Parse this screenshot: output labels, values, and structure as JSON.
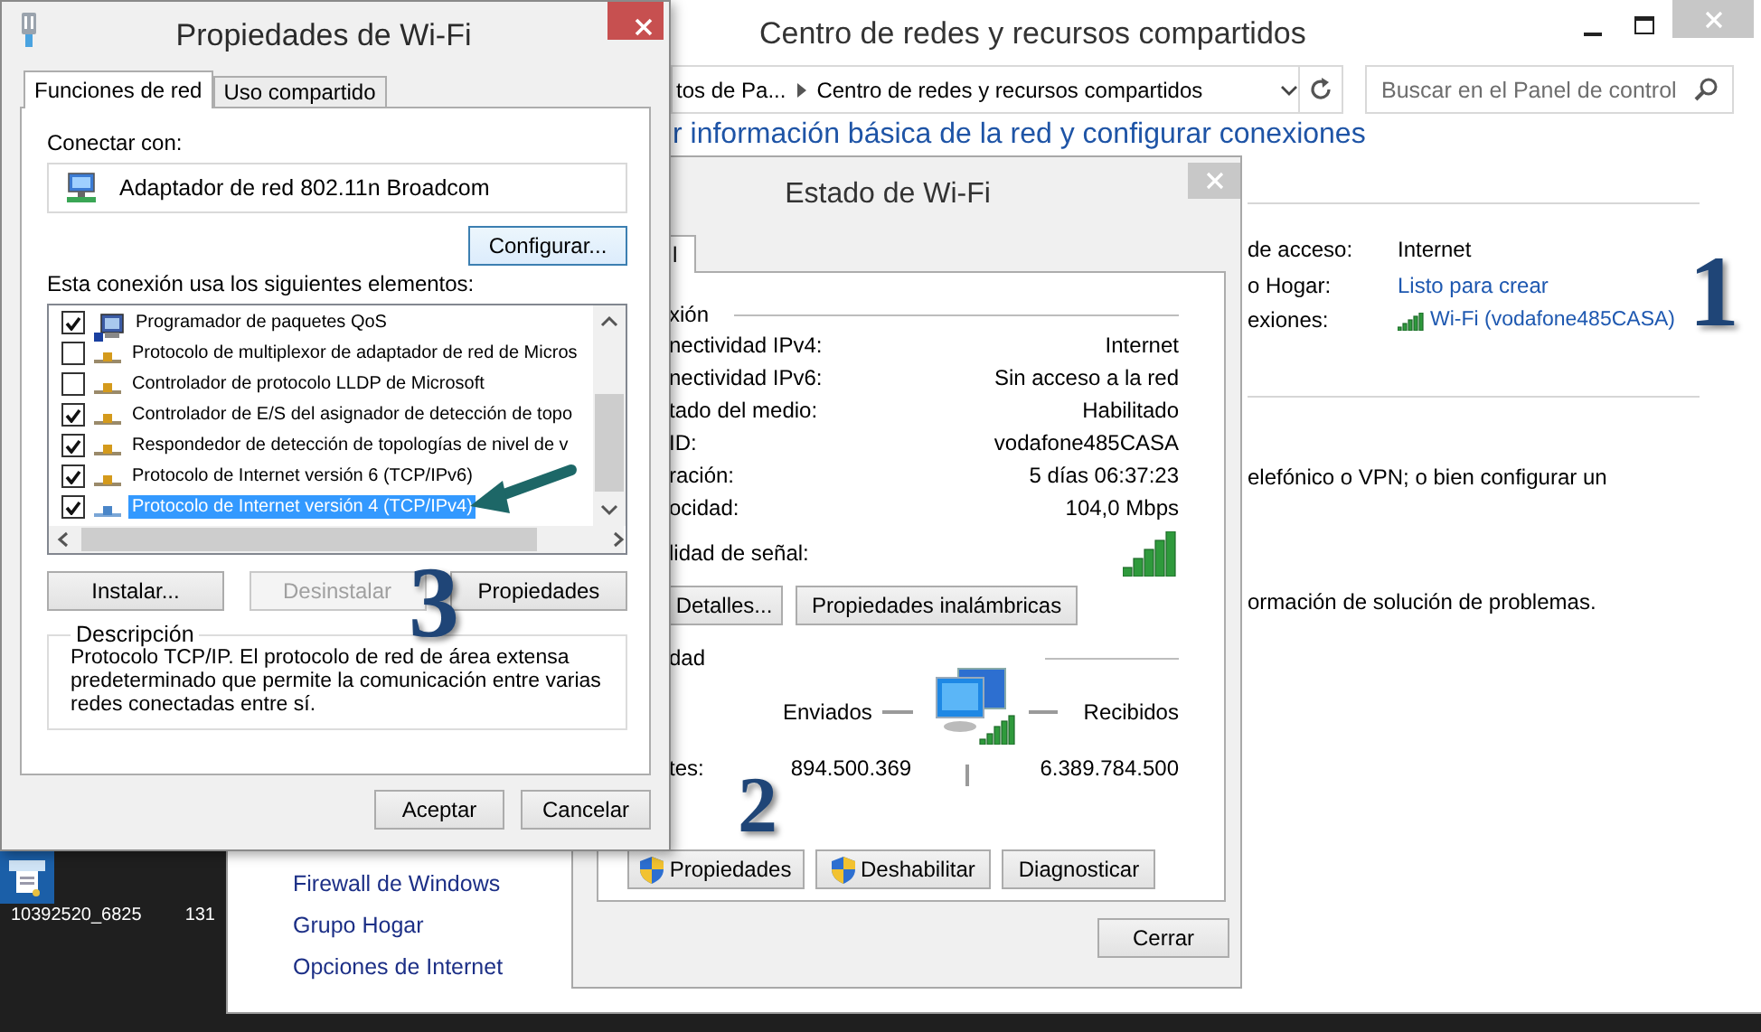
{
  "desktop": {
    "icon_labels": [
      "10392520_6825",
      "131"
    ]
  },
  "network_center": {
    "title": "Centro de redes y recursos compartidos",
    "breadcrumb": [
      "tos de Pa...",
      "Centro de redes y recursos compartidos"
    ],
    "search": {
      "placeholder": "Buscar en el Panel de control"
    },
    "heading": "r información básica de la red y configurar conexiones",
    "details": [
      {
        "label": "de acceso:",
        "value": "Internet",
        "kind": "text"
      },
      {
        "label": "o Hogar:",
        "value": "Listo para crear",
        "kind": "link"
      },
      {
        "label": "exiones:",
        "value": "Wi-Fi (vodafone485CASA)",
        "kind": "wifi"
      }
    ],
    "paragraphs": [
      "elefónico o VPN; o bien configurar un",
      "ormación de solución de problemas."
    ],
    "see_also": [
      "Firewall de Windows",
      "Grupo Hogar",
      "Opciones de Internet"
    ]
  },
  "wifi_status": {
    "title": "Estado de Wi-Fi",
    "tab": "l",
    "connection_heading": "xión",
    "rows": [
      {
        "label": "nectividad IPv4:",
        "value": "Internet"
      },
      {
        "label": "nectividad IPv6:",
        "value": "Sin acceso a la red"
      },
      {
        "label": "tado del medio:",
        "value": "Habilitado"
      },
      {
        "label": "ID:",
        "value": "vodafone485CASA"
      },
      {
        "label": "ración:",
        "value": "5 días 06:37:23"
      },
      {
        "label": "ocidad:",
        "value": "104,0 Mbps"
      }
    ],
    "signal_label": "lidad de señal:",
    "detail_buttons": [
      "Detalles...",
      "Propiedades inalámbricas"
    ],
    "activity_heading": "dad",
    "sent_label": "Enviados",
    "received_label": "Recibidos",
    "bytes_label": "tes:",
    "bytes_sent": "894.500.369",
    "bytes_received": "6.389.784.500",
    "action_buttons": [
      {
        "label": "Propiedades",
        "shield": true
      },
      {
        "label": "Deshabilitar",
        "shield": true
      },
      {
        "label": "Diagnosticar",
        "shield": false
      }
    ],
    "close_button": "Cerrar"
  },
  "wifi_properties": {
    "title": "Propiedades de Wi-Fi",
    "tabs": [
      {
        "label": "Funciones de red",
        "selected": true
      },
      {
        "label": "Uso compartido",
        "selected": false
      }
    ],
    "connect_label": "Conectar con:",
    "adapter": "Adaptador de red 802.11n Broadcom",
    "configure_button": {
      "label": "Configurar...",
      "focused": true
    },
    "items_label": "Esta conexión usa los siguientes elementos:",
    "items": [
      {
        "label": "Programador de paquetes QoS",
        "kind": "service",
        "checked": true,
        "selected": false
      },
      {
        "label": "Protocolo de multiplexor de adaptador de red de Micros",
        "kind": "protocol",
        "checked": false,
        "selected": false
      },
      {
        "label": "Controlador de protocolo LLDP de Microsoft",
        "kind": "protocol",
        "checked": false,
        "selected": false
      },
      {
        "label": "Controlador de E/S del asignador de detección de topo",
        "kind": "protocol",
        "checked": true,
        "selected": false
      },
      {
        "label": "Respondedor de detección de topologías de nivel de v",
        "kind": "protocol",
        "checked": true,
        "selected": false
      },
      {
        "label": "Protocolo de Internet versión 6 (TCP/IPv6)",
        "kind": "protocol",
        "checked": true,
        "selected": false
      },
      {
        "label": "Protocolo de Internet versión 4 (TCP/IPv4)",
        "kind": "protocol",
        "checked": true,
        "selected": true
      }
    ],
    "buttons": [
      {
        "label": "Instalar...",
        "disabled": false
      },
      {
        "label": "Desinstalar",
        "disabled": true
      },
      {
        "label": "Propiedades",
        "disabled": false
      }
    ],
    "description_label": "Descripción",
    "description": "Protocolo TCP/IP. El protocolo de red de área extensa predeterminado que permite la comunicación entre varias redes conectadas entre sí.",
    "ok_button": "Aceptar",
    "cancel_button": "Cancelar"
  },
  "annotations": [
    {
      "label": "1"
    },
    {
      "label": "2"
    },
    {
      "label": "3"
    }
  ]
}
